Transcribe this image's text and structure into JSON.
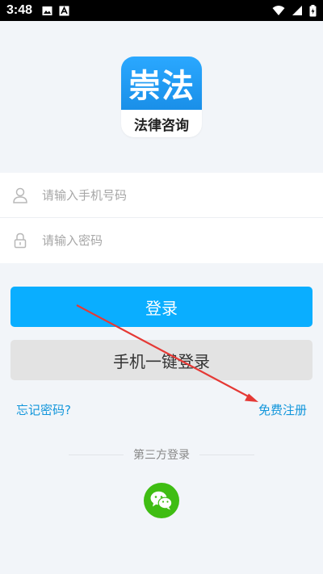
{
  "status_bar": {
    "time": "3:48",
    "icons_left": [
      "image-icon",
      "a-icon"
    ],
    "icons_right": [
      "wifi-icon",
      "signal-icon",
      "battery-icon"
    ]
  },
  "logo": {
    "title": "崇法",
    "subtitle": "法律咨询",
    "accent": "#1e9bf0"
  },
  "form": {
    "phone_placeholder": "请输入手机号码",
    "password_placeholder": "请输入密码"
  },
  "buttons": {
    "login_label": "登录",
    "phone_login_label": "手机一键登录"
  },
  "links": {
    "forgot_password": "忘记密码?",
    "register": "免费注册"
  },
  "third_party": {
    "label": "第三方登录",
    "wechat_icon": "wechat-icon"
  },
  "colors": {
    "primary": "#0aaeff",
    "link": "#1296db",
    "annotation": "#e53935",
    "wechat": "#3fbd13"
  }
}
